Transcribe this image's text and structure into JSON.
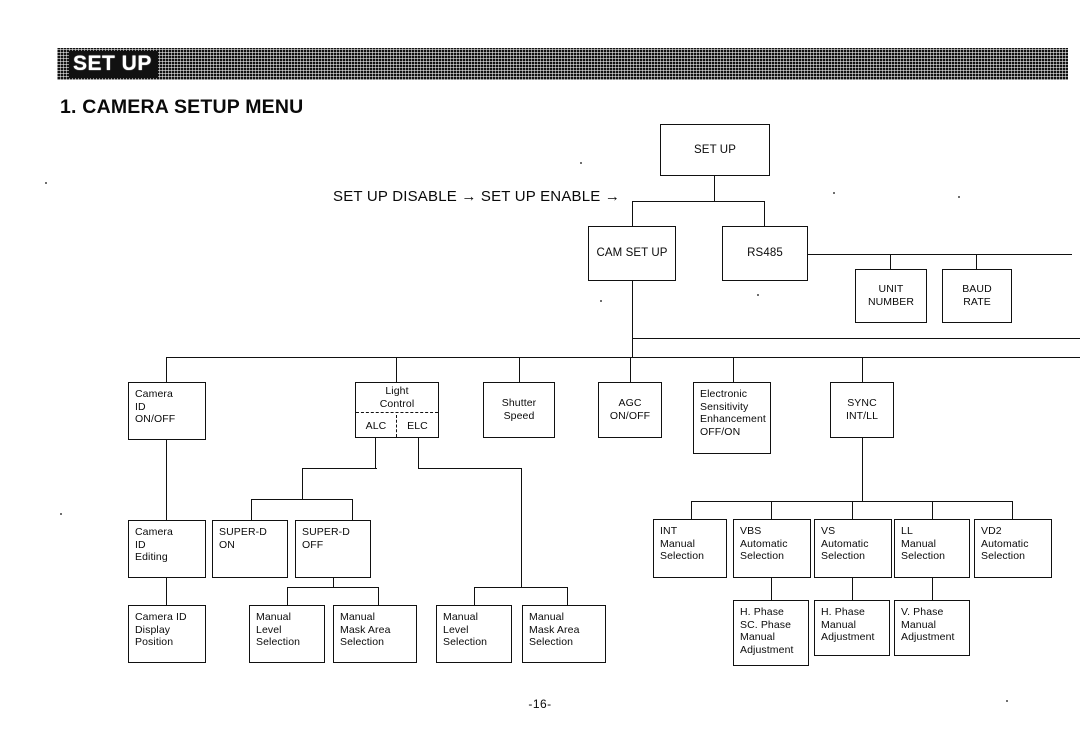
{
  "header": {
    "banner_title": "SET UP",
    "section_title": "1. CAMERA SETUP MENU"
  },
  "flow_label": "SET UP DISABLE → SET UP ENABLE →",
  "page_number": "-16-",
  "nodes": {
    "set_up": {
      "lines": [
        "SET UP"
      ]
    },
    "cam_set_up": {
      "lines": [
        "CAM SET UP"
      ]
    },
    "rs485": {
      "lines": [
        "RS485"
      ]
    },
    "unit_number": {
      "lines": [
        "UNIT",
        "NUMBER"
      ]
    },
    "baud_rate": {
      "lines": [
        "BAUD",
        "RATE"
      ]
    },
    "camera_id": {
      "lines": [
        "Camera",
        "ID",
        "ON/OFF"
      ]
    },
    "light_control": {
      "title": [
        "Light",
        "Control"
      ],
      "alc": "ALC",
      "elc": "ELC"
    },
    "shutter_speed": {
      "lines": [
        "Shutter",
        "Speed"
      ]
    },
    "agc": {
      "lines": [
        "AGC",
        "ON/OFF"
      ]
    },
    "ese": {
      "lines": [
        "Electronic",
        "Sensitivity",
        "Enhancement",
        "OFF/ON"
      ]
    },
    "sync": {
      "lines": [
        "SYNC",
        "INT/LL"
      ]
    },
    "camera_id_editing": {
      "lines": [
        "Camera",
        "ID",
        "Editing"
      ]
    },
    "super_d_on": {
      "lines": [
        "SUPER-D",
        "ON"
      ]
    },
    "super_d_off": {
      "lines": [
        "SUPER-D",
        "OFF"
      ]
    },
    "camera_id_display_position": {
      "lines": [
        "Camera ID",
        "Display",
        "Position"
      ]
    },
    "alc_manual_level": {
      "lines": [
        "Manual",
        "Level",
        "Selection"
      ]
    },
    "alc_manual_mask": {
      "lines": [
        "Manual",
        "Mask Area",
        "Selection"
      ]
    },
    "elc_manual_level": {
      "lines": [
        "Manual",
        "Level",
        "Selection"
      ]
    },
    "elc_manual_mask": {
      "lines": [
        "Manual",
        "Mask Area",
        "Selection"
      ]
    },
    "sync_int": {
      "lines": [
        "INT",
        "Manual",
        "Selection"
      ]
    },
    "sync_vbs": {
      "lines": [
        "VBS",
        "Automatic",
        "Selection"
      ]
    },
    "sync_vs": {
      "lines": [
        "VS",
        "Automatic",
        "Selection"
      ]
    },
    "sync_ll": {
      "lines": [
        "LL",
        "Manual",
        "Selection"
      ]
    },
    "sync_vd2": {
      "lines": [
        "VD2",
        "Automatic",
        "Selection"
      ]
    },
    "vbs_phase": {
      "lines": [
        "H. Phase",
        "SC. Phase",
        "Manual",
        "Adjustment"
      ]
    },
    "vs_phase": {
      "lines": [
        "H. Phase",
        "Manual",
        "Adjustment"
      ]
    },
    "ll_phase": {
      "lines": [
        "V. Phase",
        "Manual",
        "Adjustment"
      ]
    }
  }
}
